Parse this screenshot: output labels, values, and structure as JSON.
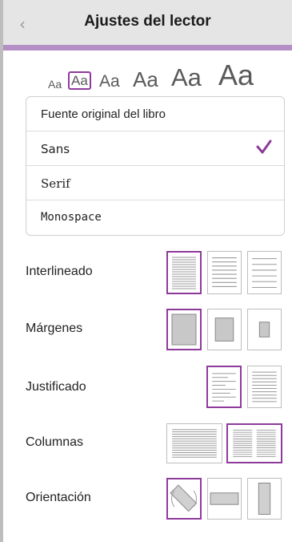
{
  "header": {
    "title": "Ajustes del lector",
    "back_icon": "chevron-left-icon"
  },
  "font_sizes": {
    "selected_index": 1,
    "items": [
      {
        "label": "Aa"
      },
      {
        "label": "Aa"
      },
      {
        "label": "Aa"
      },
      {
        "label": "Aa"
      },
      {
        "label": "Aa"
      },
      {
        "label": "Aa"
      }
    ]
  },
  "fonts": {
    "items": [
      {
        "label": "Fuente original del libro",
        "selected": false
      },
      {
        "label": "Sans",
        "selected": true
      },
      {
        "label": "Serif",
        "selected": false
      },
      {
        "label": "Monospace",
        "selected": false
      }
    ]
  },
  "settings": {
    "line_spacing": {
      "label": "Interlineado",
      "selected_index": 0
    },
    "margins": {
      "label": "Márgenes",
      "selected_index": 0
    },
    "justification": {
      "label": "Justificado",
      "selected_index": 0
    },
    "columns": {
      "label": "Columnas",
      "selected_index": 1
    },
    "orientation": {
      "label": "Orientación",
      "selected_index": 0
    }
  },
  "colors": {
    "accent": "#8e3a9b",
    "header_bg": "#e5e5e5",
    "header_bar": "#b48fc6"
  }
}
